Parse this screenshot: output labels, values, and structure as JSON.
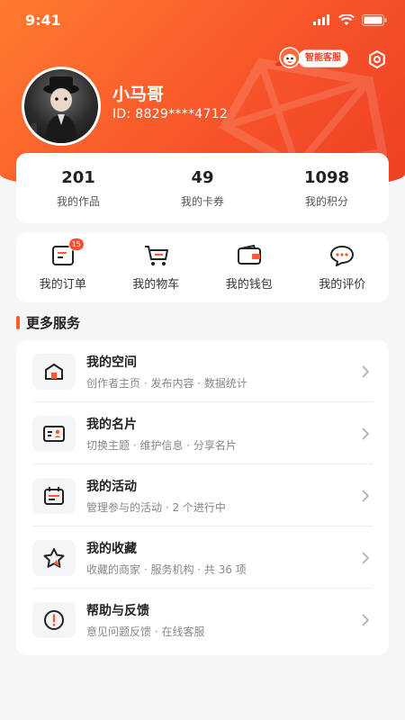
{
  "status_bar": {
    "time": "9:41"
  },
  "header": {
    "service_label": "智能客服",
    "username": "小马哥",
    "user_id": "ID: 8829****4712"
  },
  "stats": [
    {
      "value": "201",
      "label": "我的作品"
    },
    {
      "value": "49",
      "label": "我的卡券"
    },
    {
      "value": "1098",
      "label": "我的积分"
    }
  ],
  "quick_actions": [
    {
      "label": "我的订单",
      "icon": "order-icon",
      "badge": "15"
    },
    {
      "label": "我的物车",
      "icon": "cart-icon"
    },
    {
      "label": "我的钱包",
      "icon": "wallet-icon"
    },
    {
      "label": "我的评价",
      "icon": "comment-icon"
    }
  ],
  "more_services": {
    "title": "更多服务",
    "items": [
      {
        "title": "我的空间",
        "subtitle": "创作者主页 · 发布内容 · 数据统计",
        "icon": "home-icon"
      },
      {
        "title": "我的名片",
        "subtitle": "切换主题 · 维护信息 · 分享名片",
        "icon": "id-card-icon"
      },
      {
        "title": "我的活动",
        "subtitle": "管理参与的活动 · 2 个进行中",
        "icon": "calendar-icon"
      },
      {
        "title": "我的收藏",
        "subtitle": "收藏的商家 · 服务机构 · 共 36 项",
        "icon": "star-icon"
      },
      {
        "title": "帮助与反馈",
        "subtitle": "意见问题反馈 · 在线客服",
        "icon": "alert-icon"
      }
    ]
  },
  "colors": {
    "accent": "#ff5a2c",
    "accent_dark": "#ee3f24",
    "background": "#f5f6f8"
  }
}
